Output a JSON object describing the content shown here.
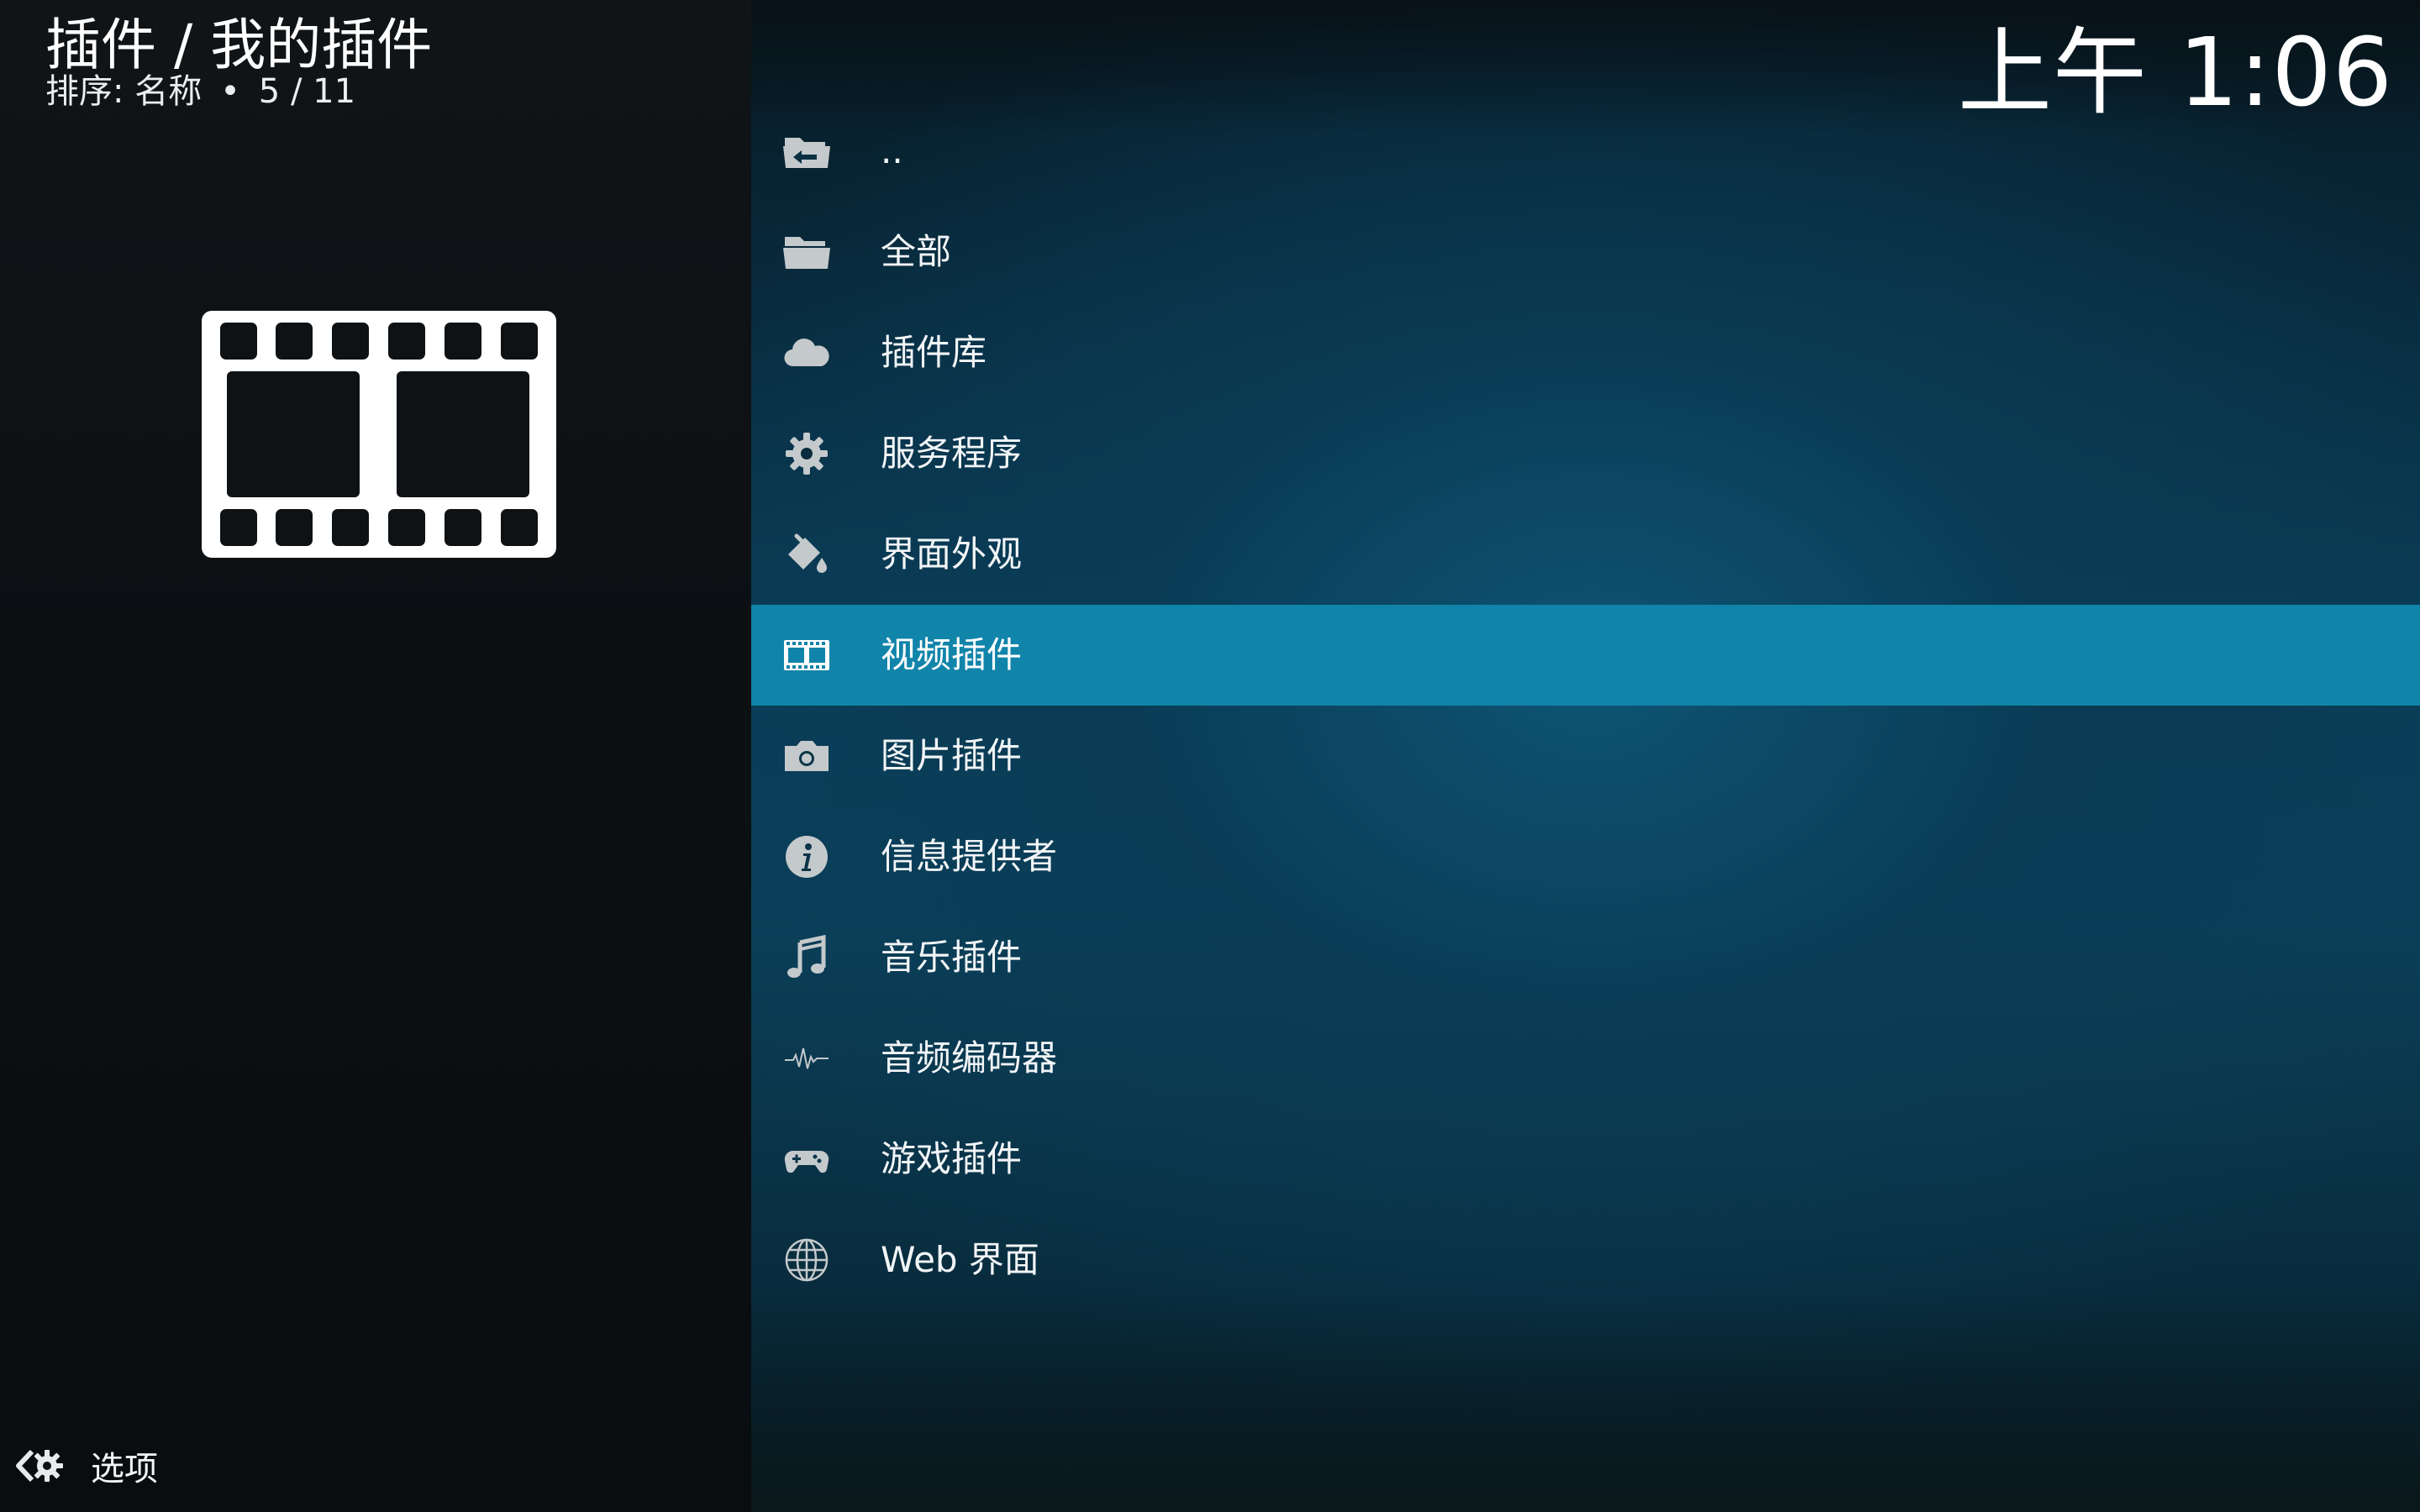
{
  "header": {
    "title": "插件 / 我的插件",
    "sort_label": "排序: 名称",
    "separator": "•",
    "position": "5 / 11"
  },
  "clock": "上午 1:06",
  "thumbnail": {
    "icon": "film-strip-icon"
  },
  "list": {
    "selected_index": 5,
    "items": [
      {
        "label": "..",
        "icon": "folder-back-icon"
      },
      {
        "label": "全部",
        "icon": "folder-open-icon"
      },
      {
        "label": "插件库",
        "icon": "cloud-icon"
      },
      {
        "label": "服务程序",
        "icon": "gear-icon"
      },
      {
        "label": "界面外观",
        "icon": "paint-bucket-icon"
      },
      {
        "label": "视频插件",
        "icon": "film-icon"
      },
      {
        "label": "图片插件",
        "icon": "camera-icon"
      },
      {
        "label": "信息提供者",
        "icon": "info-icon"
      },
      {
        "label": "音乐插件",
        "icon": "music-note-icon"
      },
      {
        "label": "音频编码器",
        "icon": "waveform-icon"
      },
      {
        "label": "游戏插件",
        "icon": "gamepad-icon"
      },
      {
        "label": "Web 界面",
        "icon": "globe-icon"
      }
    ]
  },
  "footer": {
    "options_label": "选项",
    "icon": "options-gear-icon"
  },
  "colors": {
    "selected_row": "#1184aa",
    "icon_gray": "#c4c9cc",
    "left_panel": "#0f1316"
  }
}
